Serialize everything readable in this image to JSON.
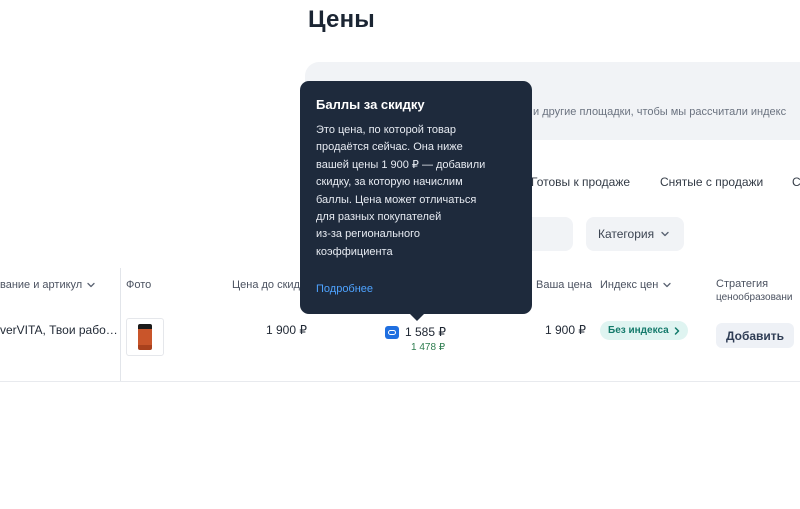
{
  "page": {
    "title": "Цены"
  },
  "banner": {
    "text": "и другие площадки, чтобы мы рассчитали индекс"
  },
  "tabs": [
    {
      "label": "Готовы к продаже"
    },
    {
      "label": "Снятые с продажи"
    },
    {
      "label": "С"
    }
  ],
  "filters": {
    "category_label": "Категория"
  },
  "table": {
    "headers": {
      "name": "вание и артикул",
      "photo": "Фото",
      "price_before": "Цена до скидк",
      "your_price": "Ваша цена",
      "price_index": "Индекс цен",
      "strategy_line1": "Стратегия",
      "strategy_line2": "ценообразовани"
    },
    "rows": [
      {
        "name": "verVITA, Твои рабо…",
        "price_before": "1 900 ₽",
        "points_price": "1 585 ₽",
        "points_sub": "1 478 ₽",
        "your_price": "1 900 ₽",
        "index_badge": "Без индекса",
        "action": "Добавить"
      }
    ]
  },
  "tooltip": {
    "title": "Баллы за скидку",
    "body": "Это цена, по которой товар\nпродаётся сейчас. Она ниже\nвашей цены 1 900 ₽ — добавили\nскидку, за которую начислим\nбаллы. Цена может отличаться\nдля разных покупателей\nиз-за регионального\nкоэффициента",
    "link": "Подробнее"
  },
  "colors": {
    "tooltip_bg": "#1e2a3c",
    "link": "#4ea3ff",
    "badge_bg": "#dff4f1",
    "badge_text": "#147a6b",
    "points_icon": "#1f6fe0",
    "sub_price": "#2e7d4f"
  },
  "icons": {
    "chevron": "chevron-down-icon",
    "points": "points-icon",
    "badge_arrow": "chevron-right-icon"
  }
}
